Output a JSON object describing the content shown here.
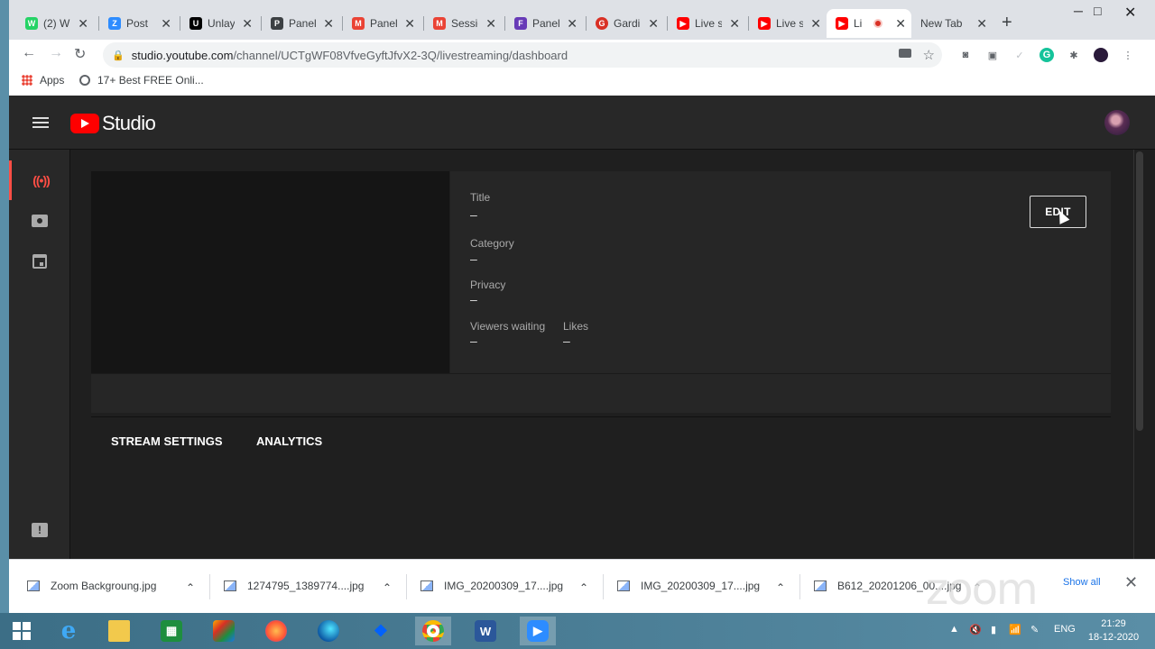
{
  "browser": {
    "tabs": [
      {
        "label": "(2) W",
        "color": "#25d366",
        "glyph": "W"
      },
      {
        "label": "Post",
        "color": "#2d8cff",
        "glyph": "Z"
      },
      {
        "label": "Unlay",
        "color": "#000000",
        "glyph": "U"
      },
      {
        "label": "Panel",
        "color": "#3c4043",
        "glyph": "P"
      },
      {
        "label": "Panel",
        "color": "#ea4335",
        "glyph": "M"
      },
      {
        "label": "Sessio",
        "color": "#ea4335",
        "glyph": "M"
      },
      {
        "label": "Panel",
        "color": "#673ab7",
        "glyph": "F"
      },
      {
        "label": "Gardi",
        "color": "#d93025",
        "glyph": "G"
      },
      {
        "label": "Live s",
        "color": "#ff0000",
        "glyph": "▶"
      },
      {
        "label": "Live s",
        "color": "#ff0000",
        "glyph": "▶"
      },
      {
        "label": "Li",
        "color": "#ff0000",
        "glyph": "▶"
      },
      {
        "label": "New Tab",
        "color": "",
        "glyph": ""
      }
    ],
    "url_host": "studio.youtube.com",
    "url_path": "/channel/UCTgWF08VfveGyftJfvX2-3Q/livestreaming/dashboard",
    "bookmarks": {
      "apps": "Apps",
      "item1": "17+ Best FREE Onli..."
    }
  },
  "studio": {
    "logo_text": "Studio",
    "fields": {
      "title_label": "Title",
      "title_value": "–",
      "category_label": "Category",
      "category_value": "–",
      "privacy_label": "Privacy",
      "privacy_value": "–",
      "viewers_label": "Viewers waiting",
      "viewers_value": "–",
      "likes_label": "Likes",
      "likes_value": "–"
    },
    "edit_label": "EDIT",
    "tabs": {
      "stream_settings": "STREAM SETTINGS",
      "analytics": "ANALYTICS"
    }
  },
  "downloads": {
    "items": [
      "Zoom Backgroung.jpg",
      "1274795_1389774....jpg",
      "IMG_20200309_17....jpg",
      "IMG_20200309_17....jpg",
      "B612_20201206_00....jpg"
    ],
    "show_all": "Show all",
    "watermark": "zoom"
  },
  "taskbar": {
    "lang": "ENG",
    "time": "21:29",
    "date": "18-12-2020"
  },
  "colors": {
    "accent_live": "#ff4e45",
    "yt_red": "#ff0000",
    "studio_bg": "#1f1f1f"
  }
}
